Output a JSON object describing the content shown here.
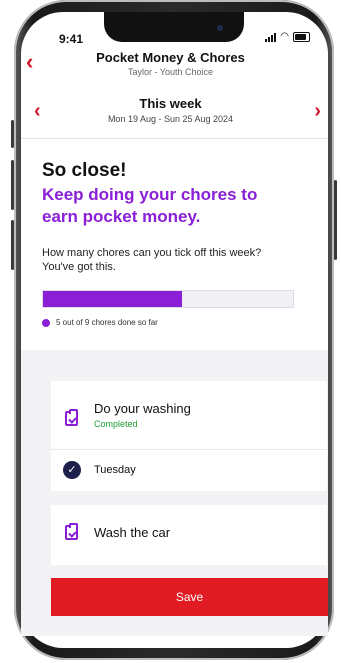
{
  "status_bar": {
    "time": "9:41"
  },
  "header": {
    "title": "Pocket Money & Chores",
    "subtitle": "Taylor - Youth Choice",
    "back_icon": "chevron-left-icon"
  },
  "week": {
    "title": "This week",
    "range": "Mon 19 Aug - Sun 25 Aug 2024",
    "prev_icon": "chevron-left-icon",
    "next_icon": "chevron-right-icon"
  },
  "message": {
    "headline": "So close!",
    "encouragement": "Keep doing your chores to earn pocket money.",
    "question": "How many chores can you tick off this week? You've got this."
  },
  "progress": {
    "done": 5,
    "total": 9,
    "fraction": 0.5556,
    "caption": "5 out of 9 chores done so far"
  },
  "chores": [
    {
      "name": "Do your washing",
      "status": "Completed",
      "day": "Tuesday",
      "icon": "clipboard-check-icon"
    },
    {
      "name": "Wash the car",
      "icon": "clipboard-check-icon"
    }
  ],
  "actions": {
    "save_label": "Save"
  },
  "colors": {
    "accent_red": "#e01b24",
    "purple": "#8a1fd6",
    "completed_green": "#1f9e3a",
    "check_navy": "#1c1f4a"
  }
}
